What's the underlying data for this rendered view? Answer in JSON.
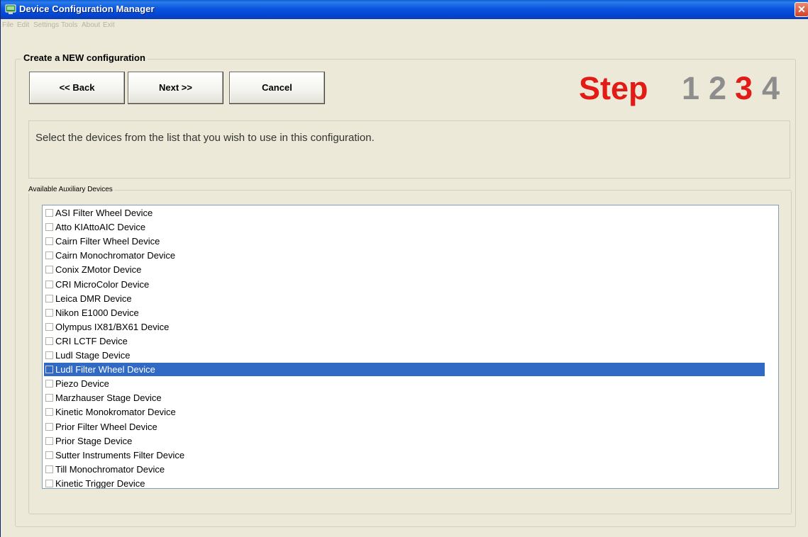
{
  "window": {
    "title": "Device Configuration Manager",
    "close_glyph": "✕"
  },
  "menu": {
    "items": [
      "File",
      "Edit",
      "Settings",
      "Tools",
      "About",
      "Exit"
    ]
  },
  "main_group": {
    "legend": "Create a NEW configuration"
  },
  "buttons": {
    "back": "<< Back",
    "next": "Next >>",
    "cancel": "Cancel"
  },
  "step": {
    "label": "Step",
    "numbers": [
      "1",
      "2",
      "3",
      "4"
    ],
    "current": "3",
    "active_color": "#e31b17",
    "inactive_color": "#8d8d8d"
  },
  "instruction": {
    "text": "Select the devices from the list that you wish to use in this configuration."
  },
  "devices": {
    "legend": "Available Auxiliary Devices",
    "selected_index": 11,
    "items": [
      "ASI Filter Wheel Device",
      "Atto KIAttoAIC Device",
      "Cairn Filter Wheel Device",
      "Cairn Monochromator Device",
      "Conix ZMotor Device",
      "CRI MicroColor Device",
      "Leica DMR Device",
      "Nikon E1000 Device",
      "Olympus IX81/BX61 Device",
      "CRI LCTF Device",
      "Ludl Stage Device",
      "Ludl Filter Wheel Device",
      "Piezo Device",
      "Marzhauser Stage Device",
      "Kinetic Monokromator Device",
      "Prior Filter Wheel Device",
      "Prior Stage Device",
      "Sutter Instruments Filter Device",
      "Till  Monochromator Device",
      "Kinetic Trigger Device"
    ]
  },
  "scrollbar": {
    "up_glyph": "▲",
    "down_glyph": "▼"
  },
  "colors": {
    "selection": "#316ac5",
    "titlebar": "#0954e0"
  }
}
